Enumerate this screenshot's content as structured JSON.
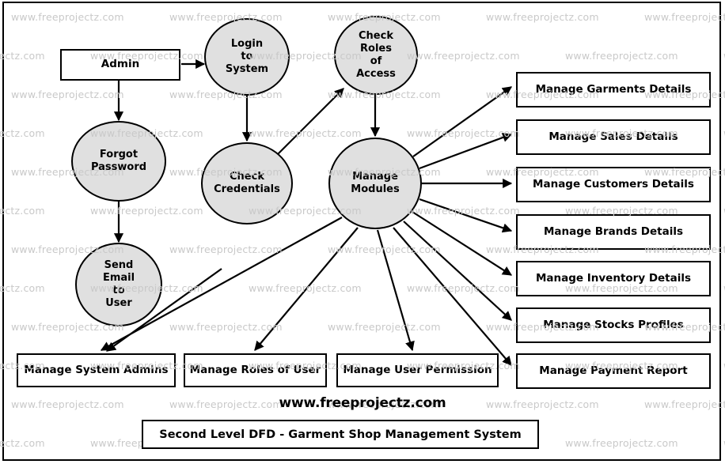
{
  "diagram": {
    "watermark_text": "www.freeprojectz.com",
    "site_caption": "www.freeprojectz.com",
    "title": "Second Level DFD - Garment Shop Management System",
    "colors": {
      "process_fill": "#e0e0e0",
      "entity_fill": "#ffffff",
      "stroke": "#000000",
      "watermark": "#c9c9c9"
    },
    "entities": [
      {
        "id": "admin",
        "label": "Admin"
      }
    ],
    "processes": [
      {
        "id": "login-to-system",
        "lines": [
          "Login",
          "to",
          "System"
        ]
      },
      {
        "id": "check-roles-of-access",
        "lines": [
          "Check",
          "Roles",
          "of",
          "Access"
        ]
      },
      {
        "id": "forgot-password",
        "lines": [
          "Forgot",
          "Password"
        ]
      },
      {
        "id": "check-credentials",
        "lines": [
          "Check",
          "Credentials"
        ]
      },
      {
        "id": "manage-modules",
        "lines": [
          "Manage",
          "Modules"
        ]
      },
      {
        "id": "send-email-to-user",
        "lines": [
          "Send",
          "Email",
          "to",
          "User"
        ]
      }
    ],
    "right_modules": [
      {
        "id": "manage-garments-details",
        "label": "Manage Garments Details"
      },
      {
        "id": "manage-sales-details",
        "label": "Manage Sales Details"
      },
      {
        "id": "manage-customers-details",
        "label": "Manage Customers Details"
      },
      {
        "id": "manage-brands-details",
        "label": "Manage Brands Details"
      },
      {
        "id": "manage-inventory-details",
        "label": "Manage Inventory Details"
      },
      {
        "id": "manage-stocks-profiles",
        "label": "Manage Stocks Profiles"
      },
      {
        "id": "manage-payment-report",
        "label": "Manage Payment Report"
      }
    ],
    "bottom_modules": [
      {
        "id": "manage-system-admins",
        "label": "Manage System Admins"
      },
      {
        "id": "manage-roles-of-user",
        "label": "Manage Roles of User"
      },
      {
        "id": "manage-user-permission",
        "label": "Manage User Permission"
      }
    ]
  }
}
